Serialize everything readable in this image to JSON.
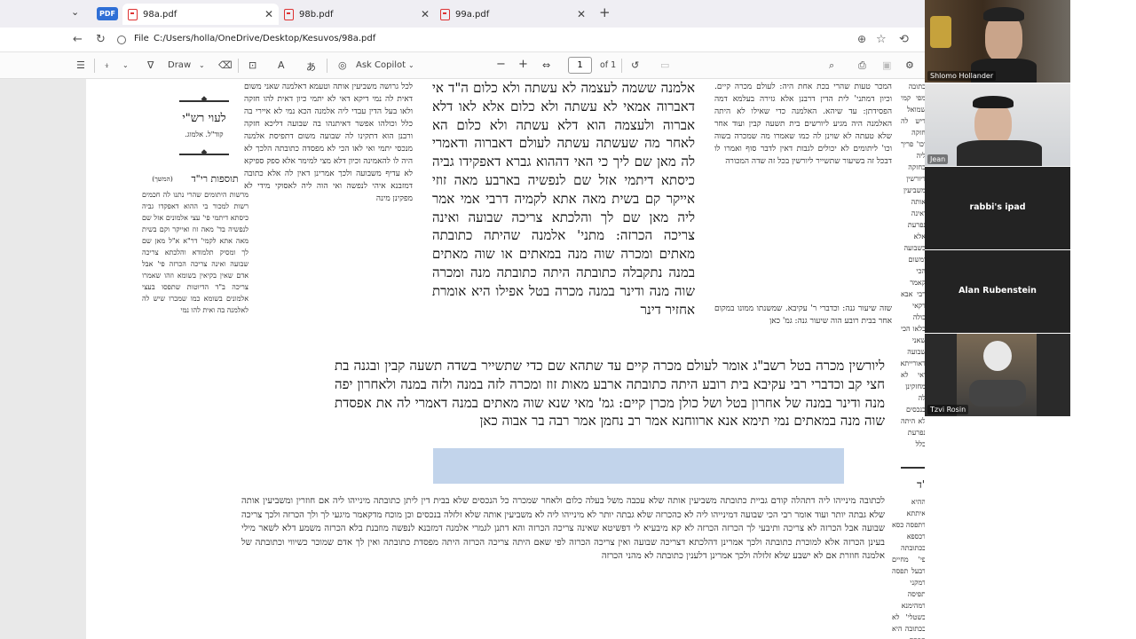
{
  "browser": {
    "tabs": [
      {
        "label": "98a.pdf",
        "active": true
      },
      {
        "label": "98b.pdf",
        "active": false
      },
      {
        "label": "99a.pdf",
        "active": false
      }
    ],
    "pdf_badge": "PDF",
    "new_tab": "+",
    "address_label": "File",
    "address": "C:/Users/holla/OneDrive/Desktop/Kesuvos/98a.pdf"
  },
  "pdf_toolbar": {
    "draw_label": "Draw",
    "copilot_label": "Ask Copilot",
    "page_current": "1",
    "page_total": "of 1",
    "zoom_out": "−",
    "zoom_in": "+"
  },
  "document": {
    "left_heading": "לעוי רש\"י",
    "left_sub": "קוד\"ל. אלמוג.",
    "tosafos_heading": "תוספות רי\"ד",
    "tosafos_sub": "(המשך)",
    "tosafos_right_heading": "תוספות רי\"ד",
    "rashi_col": "לכל גרושה משביעין אותה וטעמא דאלמנה שאני משום דאית לה נמי דיקא דאי לא יתמי כיון דאית להו חזקה ולאו בעל הדין עבדי ליה אלמנה הכא נמי לא איירי בה כלל וכולהו אפשר דאיתנהו בה שבועה דליכא חזקה ורבנן הוא דתקינו לה שבועה משום דתפיסת אלמנה מנכסי יתמי ואי לאו הכי לא מפסדה כתובתה הלכך לא היה לו להאמינה וכיון דלא מצי למימר אלא ספק ספיקא לא עדיף משבועה ולכך אמרינן דאין לה אלא כתובה דמזבנא איהי לנפשה ואי הוה ליה לאסוקי מידי לא מפקינן מינה",
    "rashi_col2": "כתובה מפי קמי שמואל דיש לה חזקה וכו' פריך ליה בחזקה דיורשין משביעין אותה ואינה נפרעת אלא בשבועה ומשום הכי קאמר רבי אבא דקאי כולה בלאו הכי שאני שבועה דאורייתא ואי לא מחזקינן לה בנכסים לא היתה נפרעת כלל וקיימא לן דיורשין אינם חייבים לפרוע לה אלא בשבועה ושמעינן מינה דהלכתא כרבא דאמר משביעין אותה ולכך אמרינן שמואל לא תקנו אלא לכתובה בלבד ולא לשאר מילי אבל אלמנה שמכרה כתובתה שלא בבית דין ודאי משביעין אותה",
    "gemara": "אלמנה ששמה לעצמה לא עשתה ולא כלום ה\"ד אי דאברוה אמאי לא עשתה ולא כלום אלא לאו דלא אברוה ולעצמה הוא דלא עשתה ולא כלום הא לאחר מה שעשתה עשתה לעולם דאברוה ודאמרי לה מאן שם ליך כי האי דההוא גברא דאפקידו גביה כיסתא דיתמי אזל שם לנפשיה בארבע מאה זוזי אייקר קם בשית מאה אתא לקמיה דרבי אמי אמר ליה מאן שם לך והלכתא צריכה שבועה ואינה צריכה הכרזה: מתני' אלמנה שהיתה כתובתה מאתים ומכרה שוה מנה במאתים או שוה מאתים במנה נתקבלה כתובתה היתה כתובתה מנה ומכרה שוה מנה ודינר במנה מכרה בטל אפילו היא אומרת אחזיר דינר",
    "gemara2": "ליורשין מכרה בטל רשב\"ג אומר לעולם מכרה קיים עד שתהא שם כדי שתשייר בשדה תשעה קבין ובגנה בת חצי קב וכדברי רבי עקיבא בית רובע היתה כתובתה ארבע מאות זוז ומכרה לזה במנה ולזה במנה ולאחרון יפה מנה ודינר במנה של אחרון בטל ושל כולן מכרן קיים: גמ' מאי שנא שוה מאתים במנה דאמרי לה את אפסדת שוה מנה במאתים נמי תימא אנא ארווחנא אמר רב נחמן אמר רבה בר אבוה כאן",
    "right_col": "המכר טעות שהרי בכת אחת היה: לעולם מכרה קיים. וכיון דמתני' לית הדין דרבנן אלא גזירה בעלמא דמה הפסידתן: עד שיהא. האלמנה כדי שאילו לא היתה האלמנה היה מגיע ליורשים בית תשעה קבין ועוד אחר שלא טעתה לא שוינן לה כמו שאמרו מה שמכרה בשוה וכו' ליתומים לא יכולים לגבות דאין לדבר סוף ואמרו לו דבכל זה בשיעור שתשייר ליורשין בכל זה שדה המכורה",
    "right_col2": "שזה שיעור גנה: וכדברי ר' עקיבא. שמשנתו ממונו במקום אחר בבית רובע הוה שיעור גנה: גמ' כאן",
    "tosafos_left": "מרשות היתומים שהרי נתנו לה חכמים רשות למכור בי ההוא דאפקדו גביה כיסתא דיתמי פי' עצי אלמונים אזל שם לנפשיה בד' מאה זוז ואייקר וקם בשית מאה אתא לקמי' דר\"א א\"ל מאן שם לך ומסיק תלמודא והלכתא צריכה שבועה ואינה צריכה הכרזה פי' אבל אדם שאין בקיאין בשומא וזהו שאמרו צריכה ב\"ד הדיוטות שתפסו בעצי אלמונים בשומא כמו שמכרו שיש לה לאלמנה בה ואית להו נמי",
    "tosafos_right": "ההיא איתתא דתפסה כסא דכספא בכתובתה פי' מחיים דבעל תפסה דמקני תפיסה דמהימנא בשטלי' לא ככתובה היא תפסה שיעור כתובתה לפרוע לה אלמנה דלא הוי לה קיימא מכי",
    "bottom_text": "לכתובה מינייהו ליה דתהלה קודם גביית כתובתה משביעין אותה שלא עכבה משל בעלה כלום ולאחר שמכרה כל הנכסים שלא בבית דין ליתן כתובתה מינייהו ליה אם חוזרין ומשביעין אותה שלא גבתה יותר ועוד אומר רבי הכי שבועה דמינייהו ליה לא כהכרזה שלא גבתה יותר לא מינייהו ליה לא משביעין אותה שלא זלזלה בנכסים וכן מוכח מדקאמר מיגעי לך ולך הכרזה ולכך צריכה שבועה אבל הכרזה לא צריכה ותיבעי לך הכרזה הכרזה לא קא מיבעיא לי דפשיטא שאינה צריכה הכרזה והא דתנן לגמרי אלמנה דמזבנא לנפשה מוזבנת בלא הכרזה משמע דלא לשאר מילי בעינן הכרזה אלא למוכרת כתובתה ולכך אמרינן דהלכתא דצריכה שבועה ואין צריכה הכרזה לפי שאם היתה צריכה הכרזה היתה מפסדת כתובתה ואין לך אדם שמוכר כשיווי וכתובתה של אלמנה חוזרת אם לא ישבע שלא זלזלה ולכך אמרינן דלענין כתובתה לא מהני הכרזה"
  },
  "participants": [
    {
      "name": "Shlomo Hollander",
      "type": "video"
    },
    {
      "name": "Jean",
      "type": "video"
    },
    {
      "name": "rabbi's ipad",
      "type": "name"
    },
    {
      "name": "Alan Rubenstein",
      "type": "name"
    },
    {
      "name": "Tzvi Rosin",
      "type": "video"
    }
  ],
  "colors": {
    "tabbar": "#efeef3",
    "highlight": "#78a0d2",
    "pdf_badge": "#2f6fd6",
    "tile_dark": "#232323"
  }
}
